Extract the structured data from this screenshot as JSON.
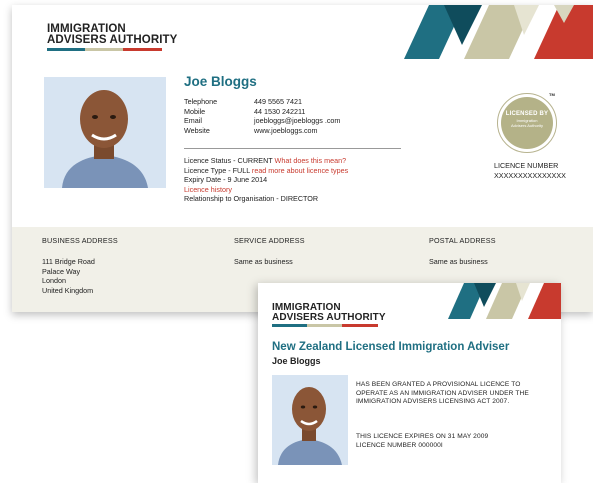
{
  "colors": {
    "teal": "#1f6f82",
    "dark_teal": "#0f4c5c",
    "tan": "#c9c6a6",
    "red": "#c83a2e",
    "panel": "#f1f0e8"
  },
  "logo": {
    "line1": "IMMIGRATION",
    "line2": "ADVISERS AUTHORITY"
  },
  "profile": {
    "name": "Joe Bloggs",
    "contact": [
      {
        "label": "Telephone",
        "value": "449 5565 7421"
      },
      {
        "label": "Mobile",
        "value": "44 1530 242211"
      },
      {
        "label": "Email",
        "value": "joebloggs@joebloggs .com"
      },
      {
        "label": "Website",
        "value": "www.joebloggs.com"
      }
    ],
    "licence_status": "Licence Status - CURRENT",
    "licence_status_link": "What does this mean?",
    "licence_type": "Licence Type - FULL",
    "licence_type_link": "read more about licence types",
    "expiry": "Expiry Date - 9 June 2014",
    "history_link": "Licence history",
    "relationship": "Relationship to Organisation - DIRECTOR"
  },
  "seal": {
    "line1": "LICENSED BY",
    "line2": "Immigration",
    "line3": "Advisers Authority",
    "tm": "TM"
  },
  "licence_number": {
    "label": "LICENCE NUMBER",
    "value": "XXXXXXXXXXXXXXX"
  },
  "addresses": {
    "business": {
      "title": "BUSINESS ADDRESS",
      "lines": [
        "111 Bridge Road",
        "Palace Way",
        "London",
        "United Kingdom"
      ]
    },
    "service": {
      "title": "SERVICE ADDRESS",
      "lines": [
        "Same as business"
      ]
    },
    "postal": {
      "title": "POSTAL ADDRESS",
      "lines": [
        "Same as business"
      ]
    }
  },
  "certificate": {
    "title": "New Zealand Licensed Immigration Adviser",
    "name": "Joe Bloggs",
    "grant_text": [
      "HAS BEEN GRANTED A PROVISIONAL LICENCE TO",
      "OPERATE AS AN IMMIGRATION ADVISER UNDER THE",
      "IMMIGRATION ADVISERS LICENSING ACT 2007."
    ],
    "expiry_text": "THIS LICENCE EXPIRES ON 31 MAY 2009",
    "number_text": "LICENCE NUMBER 000000I"
  }
}
